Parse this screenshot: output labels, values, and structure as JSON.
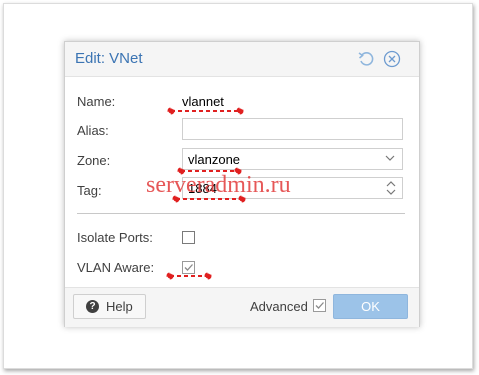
{
  "dialog": {
    "title": "Edit: VNet",
    "help_label": "Help",
    "advanced_label": "Advanced",
    "advanced_checked": true,
    "ok_label": "OK"
  },
  "form": {
    "name_label": "Name:",
    "name_value": "vlannet",
    "alias_label": "Alias:",
    "alias_value": "",
    "zone_label": "Zone:",
    "zone_value": "vlanzone",
    "tag_label": "Tag:",
    "tag_value": "1884",
    "isolate_label": "Isolate Ports:",
    "isolate_checked": false,
    "vlan_aware_label": "VLAN Aware:",
    "vlan_aware_checked": true
  },
  "watermark": "serveradmin.ru",
  "colors": {
    "title": "#3b74b3",
    "ok_button": "#9cc3e8",
    "annotation": "#e02020"
  },
  "icons": [
    "reset-icon",
    "close-icon",
    "chevron-down-icon",
    "spinner-icon",
    "help-icon",
    "checkmark-icon"
  ]
}
